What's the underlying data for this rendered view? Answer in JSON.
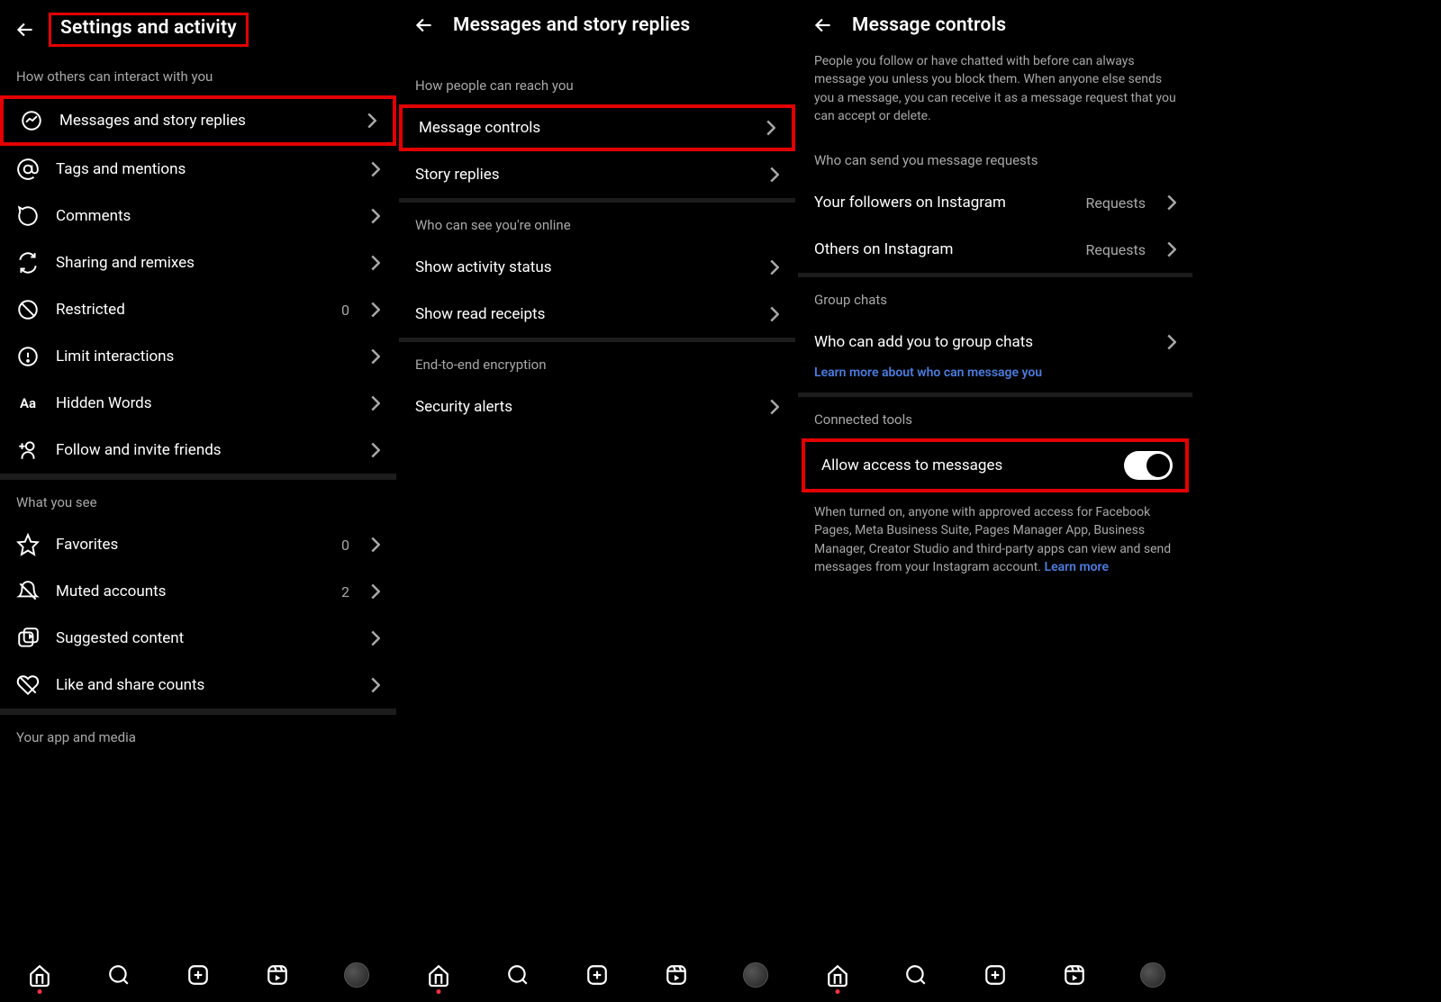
{
  "panel1": {
    "title": "Settings and activity",
    "section_interact": "How others can interact with you",
    "items_interact": [
      {
        "label": "Messages and story replies",
        "highlight": true
      },
      {
        "label": "Tags and mentions"
      },
      {
        "label": "Comments"
      },
      {
        "label": "Sharing and remixes"
      },
      {
        "label": "Restricted",
        "value": "0"
      },
      {
        "label": "Limit interactions"
      },
      {
        "label": "Hidden Words"
      },
      {
        "label": "Follow and invite friends"
      }
    ],
    "section_see": "What you see",
    "items_see": [
      {
        "label": "Favorites",
        "value": "0"
      },
      {
        "label": "Muted accounts",
        "value": "2"
      },
      {
        "label": "Suggested content"
      },
      {
        "label": "Like and share counts"
      }
    ],
    "section_app": "Your app and media"
  },
  "panel2": {
    "title": "Messages and story replies",
    "section_reach": "How people can reach you",
    "items_reach": [
      {
        "label": "Message controls",
        "highlight": true
      },
      {
        "label": "Story replies"
      }
    ],
    "section_online": "Who can see you're online",
    "items_online": [
      {
        "label": "Show activity status"
      },
      {
        "label": "Show read receipts"
      }
    ],
    "section_e2e": "End-to-end encryption",
    "items_e2e": [
      {
        "label": "Security alerts"
      }
    ]
  },
  "panel3": {
    "title": "Message controls",
    "intro": "People you follow or have chatted with before can always message you unless you block them. When anyone else sends you a message, you can receive it as a message request that you can accept or delete.",
    "section_requests": "Who can send you message requests",
    "items_requests": [
      {
        "label": "Your followers on Instagram",
        "value": "Requests"
      },
      {
        "label": "Others on Instagram",
        "value": "Requests"
      }
    ],
    "section_groups": "Group chats",
    "items_groups": [
      {
        "label": "Who can add you to group chats"
      }
    ],
    "learn_more_link": "Learn more about who can message you",
    "section_tools": "Connected tools",
    "toggle_label": "Allow access to messages",
    "toggle_desc": "When turned on, anyone with approved access for Facebook Pages, Meta Business Suite, Pages Manager App, Business Manager, Creator Studio and third-party apps can view and send messages from your Instagram account. ",
    "toggle_desc_link": "Learn more"
  }
}
